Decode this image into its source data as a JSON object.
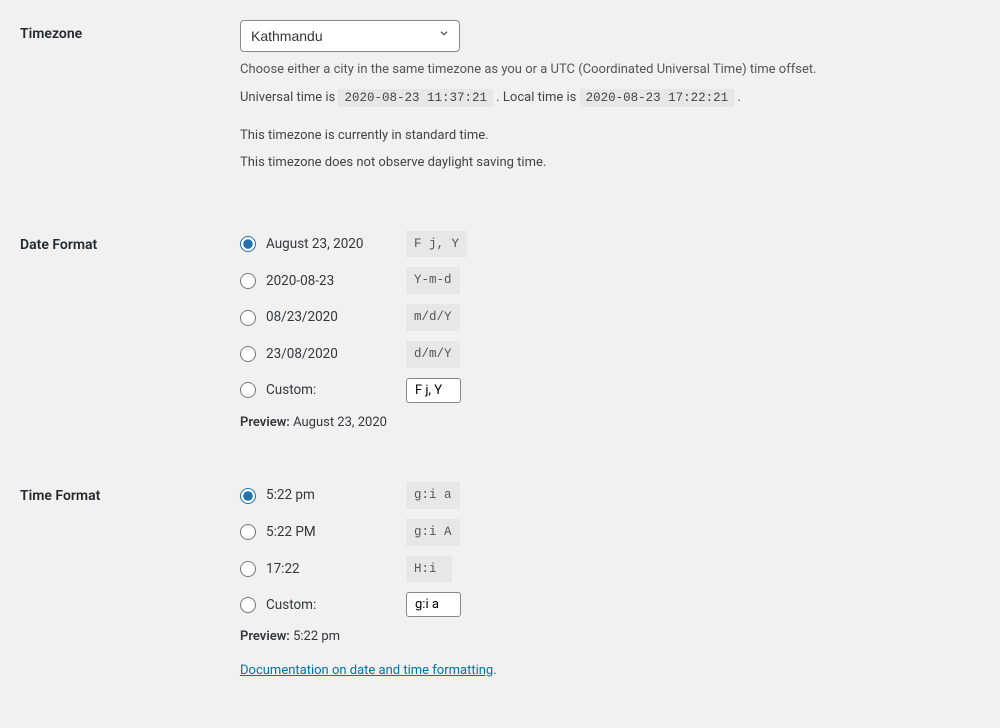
{
  "timezone": {
    "label": "Timezone",
    "value": "Kathmandu",
    "help": "Choose either a city in the same timezone as you or a UTC (Coordinated Universal Time) time offset.",
    "universal_prefix": "Universal time is ",
    "universal_value": "2020-08-23 11:37:21",
    "local_prefix": ". Local time is ",
    "local_value": "2020-08-23 17:22:21",
    "suffix": ".",
    "standard_note": "This timezone is currently in standard time.",
    "dst_note": "This timezone does not observe daylight saving time."
  },
  "date_format": {
    "label": "Date Format",
    "options": [
      {
        "label": "August 23, 2020",
        "format": "F j, Y",
        "checked": true
      },
      {
        "label": "2020-08-23",
        "format": "Y-m-d",
        "checked": false
      },
      {
        "label": "08/23/2020",
        "format": "m/d/Y",
        "checked": false
      },
      {
        "label": "23/08/2020",
        "format": "d/m/Y",
        "checked": false
      }
    ],
    "custom_label": "Custom:",
    "custom_value": "F j, Y",
    "preview_label": "Preview:",
    "preview_value": "August 23, 2020"
  },
  "time_format": {
    "label": "Time Format",
    "options": [
      {
        "label": "5:22 pm",
        "format": "g:i a",
        "checked": true
      },
      {
        "label": "5:22 PM",
        "format": "g:i A",
        "checked": false
      },
      {
        "label": "17:22",
        "format": "H:i",
        "checked": false
      }
    ],
    "custom_label": "Custom:",
    "custom_value": "g:i a",
    "preview_label": "Preview:",
    "preview_value": "5:22 pm",
    "doc_link": "Documentation on date and time formatting"
  }
}
